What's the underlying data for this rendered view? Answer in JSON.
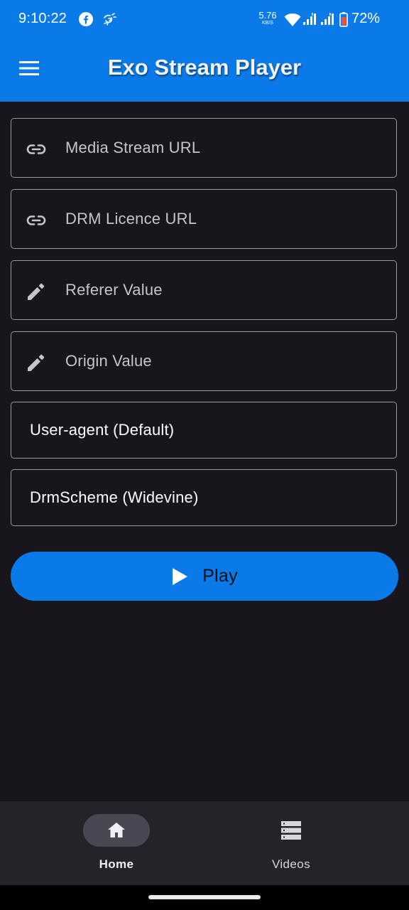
{
  "status_bar": {
    "time": "9:10:22",
    "net_speed": "5.76",
    "net_unit": "KB/S",
    "battery_pct": "72%",
    "icons": [
      "facebook-icon",
      "notification-icon",
      "wifi-icon",
      "signal-icon",
      "signal-icon",
      "battery-icon"
    ]
  },
  "app_bar": {
    "title": "Exo Stream Player",
    "menu_icon": "menu-icon"
  },
  "form": {
    "media_url": {
      "placeholder": "Media Stream URL",
      "icon": "link-icon"
    },
    "drm_url": {
      "placeholder": "DRM Licence URL",
      "icon": "link-icon"
    },
    "referer": {
      "placeholder": "Referer Value",
      "icon": "pencil-icon"
    },
    "origin": {
      "placeholder": "Origin Value",
      "icon": "pencil-icon"
    },
    "user_agent": {
      "value": "User-agent (Default)"
    },
    "drm_scheme": {
      "value": "DrmScheme (Widevine)"
    },
    "play_label": "Play",
    "play_icon": "play-icon"
  },
  "bottom_nav": {
    "items": [
      {
        "label": "Home",
        "icon": "home-icon",
        "selected": true
      },
      {
        "label": "Videos",
        "icon": "list-icon",
        "selected": false
      }
    ]
  },
  "colors": {
    "primary": "#0a7ae8",
    "background": "#18161c",
    "nav_background": "#25232a",
    "outline": "#9a97a0"
  }
}
